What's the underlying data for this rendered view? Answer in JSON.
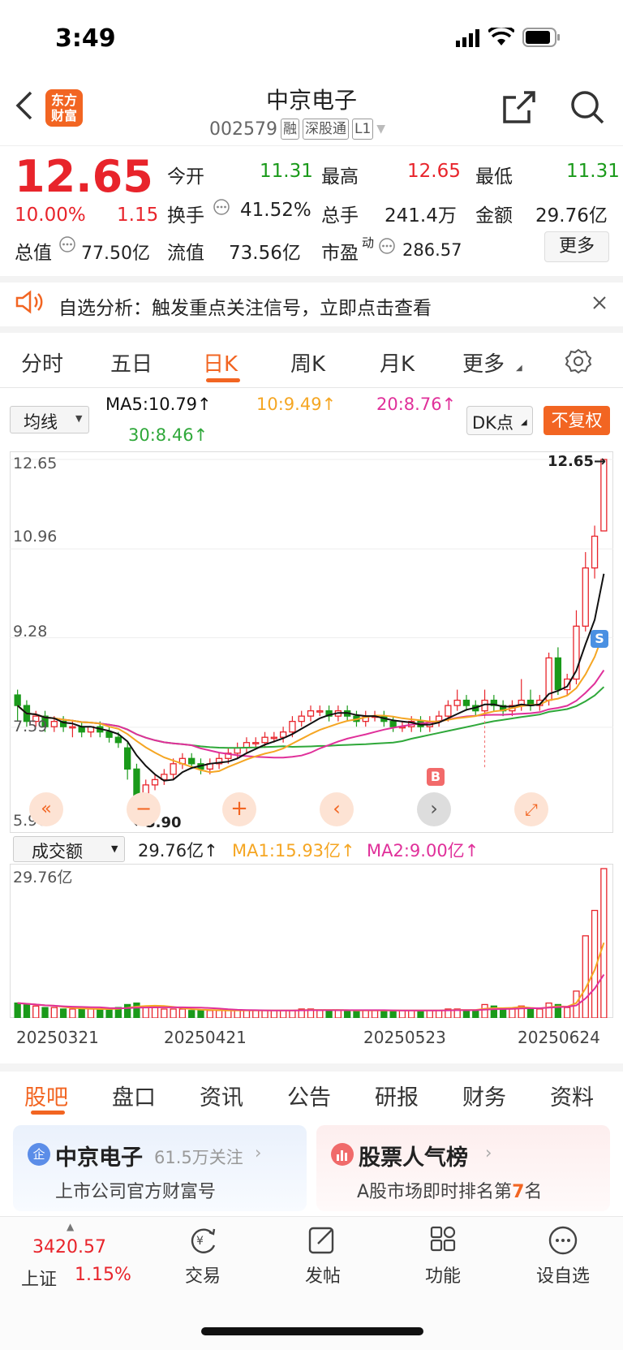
{
  "status": {
    "time": "3:49"
  },
  "header": {
    "logo_line1": "东方",
    "logo_line2": "财富",
    "title": "中京电子",
    "code": "002579",
    "tags": [
      "融",
      "深股通",
      "L1"
    ]
  },
  "quote": {
    "price": "12.65",
    "change_pct": "10.00%",
    "change": "1.15",
    "open_label": "今开",
    "open": "11.31",
    "high_label": "最高",
    "high": "12.65",
    "low_label": "最低",
    "low": "11.31",
    "turnover_label": "换手",
    "turnover": "41.52%",
    "volume_label": "总手",
    "volume": "241.4万",
    "amount_label": "金额",
    "amount": "29.76亿",
    "mktcap_label": "总值",
    "mktcap": "77.50亿",
    "float_label": "流值",
    "float": "73.56亿",
    "pe_label": "市盈",
    "pe_sup": "动",
    "pe": "286.57",
    "more_button": "更多"
  },
  "banner": {
    "text": "自选分析：触发重点关注信号，立即点击查看"
  },
  "chart_tabs": [
    "分时",
    "五日",
    "日K",
    "周K",
    "月K",
    "更多"
  ],
  "active_tab": "日K",
  "ma_bar": {
    "selector": "均线",
    "ma5": "MA5:10.79",
    "ma10": "10:9.49",
    "ma20": "20:8.76",
    "ma30": "30:8.46",
    "dk_button": "DK点",
    "adjust_button": "不复权"
  },
  "colors": {
    "red": "#e8242b",
    "green": "#1a9a1a",
    "ma5": "#111111",
    "ma10": "#f5a623",
    "ma20": "#e0309a",
    "ma30": "#2fa83a",
    "accent": "#f26522"
  },
  "kline": {
    "y_labels": [
      "12.65",
      "10.96",
      "9.28",
      "7.59",
      "5.90"
    ],
    "last_price_label": "12.65",
    "low_marker": "5.90",
    "buy_marker": "B",
    "sell_marker": "S"
  },
  "volume_bar": {
    "selector": "成交额",
    "value": "29.76亿",
    "ma1": "MA1:15.93亿",
    "ma2": "MA2:9.00亿",
    "top_label": "29.76亿"
  },
  "dates": [
    "20250321",
    "20250421",
    "20250523",
    "20250624"
  ],
  "chart_data": {
    "type": "candlestick",
    "ylim": [
      5.9,
      12.65
    ],
    "candles": [
      [
        8.2,
        8.0,
        8.3,
        7.7
      ],
      [
        8.0,
        7.7,
        8.1,
        7.6
      ],
      [
        7.7,
        7.8,
        7.9,
        7.6
      ],
      [
        7.8,
        7.6,
        7.9,
        7.5
      ],
      [
        7.6,
        7.7,
        7.8,
        7.5
      ],
      [
        7.7,
        7.6,
        7.8,
        7.5
      ],
      [
        7.6,
        7.6,
        7.7,
        7.4
      ],
      [
        7.6,
        7.5,
        7.7,
        7.4
      ],
      [
        7.5,
        7.6,
        7.6,
        7.4
      ],
      [
        7.6,
        7.5,
        7.7,
        7.4
      ],
      [
        7.5,
        7.4,
        7.6,
        7.3
      ],
      [
        7.4,
        7.3,
        7.5,
        7.2
      ],
      [
        7.2,
        6.8,
        7.3,
        6.6
      ],
      [
        6.8,
        6.3,
        6.9,
        5.9
      ],
      [
        6.3,
        6.5,
        6.6,
        5.9
      ],
      [
        6.5,
        6.6,
        6.7,
        6.4
      ],
      [
        6.6,
        6.7,
        6.8,
        6.5
      ],
      [
        6.7,
        6.9,
        7.0,
        6.6
      ],
      [
        6.9,
        7.0,
        7.1,
        6.8
      ],
      [
        7.0,
        6.9,
        7.1,
        6.8
      ],
      [
        6.9,
        6.8,
        7.0,
        6.7
      ],
      [
        6.8,
        6.9,
        7.0,
        6.7
      ],
      [
        6.9,
        7.0,
        7.1,
        6.8
      ],
      [
        7.0,
        7.1,
        7.2,
        6.9
      ],
      [
        7.1,
        7.2,
        7.3,
        7.0
      ],
      [
        7.2,
        7.3,
        7.4,
        7.1
      ],
      [
        7.3,
        7.3,
        7.4,
        7.2
      ],
      [
        7.3,
        7.4,
        7.5,
        7.2
      ],
      [
        7.4,
        7.4,
        7.5,
        7.3
      ],
      [
        7.4,
        7.5,
        7.6,
        7.3
      ],
      [
        7.5,
        7.7,
        7.8,
        7.4
      ],
      [
        7.7,
        7.8,
        7.9,
        7.6
      ],
      [
        7.8,
        7.9,
        8.0,
        7.7
      ],
      [
        7.9,
        7.9,
        8.0,
        7.8
      ],
      [
        7.9,
        7.8,
        8.0,
        7.7
      ],
      [
        7.8,
        7.9,
        8.0,
        7.7
      ],
      [
        7.9,
        7.8,
        8.0,
        7.7
      ],
      [
        7.8,
        7.7,
        7.9,
        7.6
      ],
      [
        7.7,
        7.8,
        7.9,
        7.6
      ],
      [
        7.8,
        7.8,
        7.9,
        7.7
      ],
      [
        7.8,
        7.7,
        7.9,
        7.6
      ],
      [
        7.7,
        7.6,
        7.8,
        7.5
      ],
      [
        7.6,
        7.6,
        7.7,
        7.5
      ],
      [
        7.6,
        7.7,
        7.8,
        7.5
      ],
      [
        7.7,
        7.6,
        7.8,
        7.5
      ],
      [
        7.6,
        7.7,
        7.8,
        7.5
      ],
      [
        7.7,
        7.8,
        7.9,
        7.6
      ],
      [
        7.8,
        8.0,
        8.1,
        7.7
      ],
      [
        8.0,
        8.1,
        8.3,
        7.9
      ],
      [
        8.1,
        8.0,
        8.2,
        7.9
      ],
      [
        8.0,
        7.9,
        8.1,
        7.8
      ],
      [
        7.9,
        8.1,
        8.3,
        7.8
      ],
      [
        8.1,
        8.0,
        8.2,
        7.9
      ],
      [
        8.0,
        7.9,
        8.1,
        7.8
      ],
      [
        7.9,
        8.0,
        8.1,
        7.8
      ],
      [
        8.0,
        8.1,
        8.5,
        7.9
      ],
      [
        8.1,
        8.0,
        8.3,
        7.9
      ],
      [
        8.0,
        8.1,
        8.2,
        7.9
      ],
      [
        8.1,
        8.9,
        9.0,
        8.0
      ],
      [
        8.9,
        8.3,
        9.1,
        8.2
      ],
      [
        8.3,
        8.5,
        8.6,
        8.2
      ],
      [
        8.5,
        9.5,
        9.8,
        8.4
      ],
      [
        9.5,
        10.6,
        10.9,
        9.4
      ],
      [
        10.6,
        11.2,
        11.4,
        10.4
      ],
      [
        11.3,
        12.65,
        12.65,
        11.31
      ]
    ],
    "volume_ratio": [
      0.1,
      0.09,
      0.08,
      0.07,
      0.07,
      0.06,
      0.06,
      0.06,
      0.06,
      0.06,
      0.06,
      0.07,
      0.09,
      0.1,
      0.08,
      0.07,
      0.06,
      0.06,
      0.06,
      0.05,
      0.05,
      0.05,
      0.05,
      0.05,
      0.05,
      0.05,
      0.05,
      0.05,
      0.05,
      0.05,
      0.05,
      0.06,
      0.06,
      0.05,
      0.05,
      0.05,
      0.05,
      0.05,
      0.05,
      0.05,
      0.05,
      0.05,
      0.05,
      0.05,
      0.05,
      0.05,
      0.05,
      0.06,
      0.06,
      0.05,
      0.05,
      0.09,
      0.08,
      0.06,
      0.06,
      0.08,
      0.06,
      0.06,
      0.1,
      0.09,
      0.07,
      0.18,
      0.55,
      0.72,
      1.0
    ]
  },
  "bottom_tabs": [
    "股吧",
    "盘口",
    "资讯",
    "公告",
    "研报",
    "财务",
    "资料"
  ],
  "active_bottom_tab": "股吧",
  "cards": {
    "left_title": "中京电子",
    "left_follow": "61.5万关注",
    "left_sub": "上市公司官方财富号",
    "right_title": "股票人气榜",
    "right_sub_prefix": "A股市场即时排名第",
    "right_rank": "7",
    "right_sub_suffix": "名"
  },
  "dock": {
    "index_value": "3420.57",
    "index_name": "上证",
    "index_change": "1.15%",
    "items": [
      "交易",
      "发帖",
      "功能",
      "设自选"
    ]
  }
}
